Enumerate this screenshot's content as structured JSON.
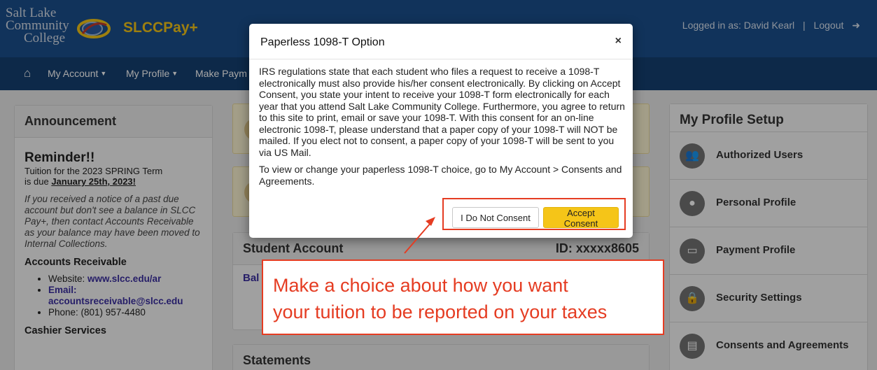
{
  "header": {
    "logo_lines": [
      "Salt Lake",
      "Community",
      "College"
    ],
    "brand": "SLCCPay+",
    "logged_in": "Logged in as: David Kearl",
    "separator": "|",
    "logout": "Logout"
  },
  "nav": {
    "home_icon": "home-icon",
    "items": [
      "My Account",
      "My Profile",
      "Make Paym"
    ]
  },
  "announcement": {
    "title": "Announcement",
    "reminder": "Reminder!!",
    "tuition_line1": "Tuition for the 2023 SPRING Term",
    "tuition_due_prefix": "is due ",
    "tuition_due_date": "January 25th, 2023!",
    "notice": "If you received a notice of a past due account but don't see a balance in SLCC Pay+, then contact Accounts Receivable as your balance may have been moved to Internal Collections.",
    "ar_heading": "Accounts Receivable",
    "website_label": "Website: ",
    "website": "www.slcc.edu/ar",
    "email_label": "Email:",
    "email": "accountsreceivable@slcc.edu",
    "phone": "Phone: (801) 957-4480",
    "cashier_heading": "Cashier Services"
  },
  "student_account": {
    "title": "Student Account",
    "id": "ID: xxxxx8605",
    "balance_partial": "Bal"
  },
  "statements": {
    "title": "Statements"
  },
  "profile_setup": {
    "title": "My Profile Setup",
    "items": [
      {
        "label": "Authorized Users",
        "icon": "users-icon"
      },
      {
        "label": "Personal Profile",
        "icon": "person-icon"
      },
      {
        "label": "Payment Profile",
        "icon": "card-icon"
      },
      {
        "label": "Security Settings",
        "icon": "lock-icon"
      },
      {
        "label": "Consents and Agreements",
        "icon": "document-icon"
      }
    ]
  },
  "modal": {
    "title": "Paperless 1098-T Option",
    "close": "×",
    "body1": "IRS regulations state that each student who files a request to receive a 1098-T electronically must also provide his/her consent electronically. By clicking on Accept Consent, you state your intent to receive your 1098-T form electronically for each year that you attend Salt Lake Community College. Furthermore, you agree to return to this site to print, email or save your 1098-T. With this consent for an on-line electronic 1098-T, please understand that a paper copy of your 1098-T will NOT be mailed. If you elect not to consent, a paper copy of your 1098-T will be sent to you via US Mail.",
    "body2": "To view or change your paperless 1098-T choice, go to My Account > Consents and Agreements.",
    "decline": "I Do Not Consent",
    "accept": "Accept Consent"
  },
  "callout": {
    "line1": "Make a choice about how you want",
    "line2": "your tuition to be reported on your taxes"
  },
  "colors": {
    "header": "#1b4f8c",
    "nav": "#153f70",
    "brand": "#f2c318",
    "accept": "#f5c518",
    "callout": "#e53c22"
  }
}
